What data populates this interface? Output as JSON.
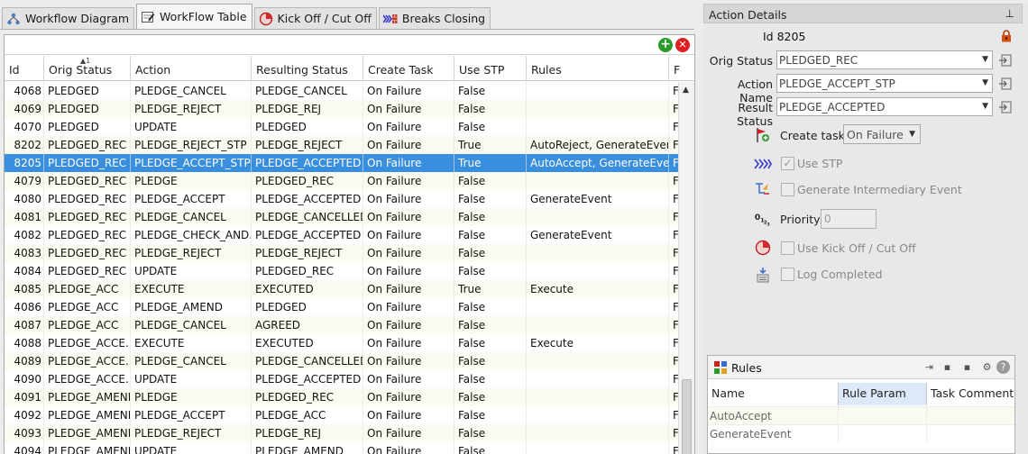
{
  "tabs": [
    {
      "label": "Workflow Diagram",
      "icon": "workflow-diagram-icon",
      "active": false
    },
    {
      "label": "WorkFlow Table",
      "icon": "table-edit-icon",
      "active": true
    },
    {
      "label": "Kick Off / Cut Off",
      "icon": "pie-clock-icon",
      "active": false
    },
    {
      "label": "Breaks Closing",
      "icon": "breaks-closing-icon",
      "active": false
    }
  ],
  "table": {
    "sort_index": "1",
    "columns": [
      "Id",
      "Orig Status",
      "Action",
      "Resulting Status",
      "Create Task",
      "Use STP",
      "Rules",
      "F"
    ],
    "rows": [
      [
        "4068",
        "PLEDGED",
        "PLEDGE_CANCEL",
        "PLEDGE_CANCEL",
        "On Failure",
        "False",
        "",
        "F"
      ],
      [
        "4069",
        "PLEDGED",
        "PLEDGE_REJECT",
        "PLEDGE_REJ",
        "On Failure",
        "False",
        "",
        "F"
      ],
      [
        "4070",
        "PLEDGED",
        "UPDATE",
        "PLEDGED",
        "On Failure",
        "False",
        "",
        "F"
      ],
      [
        "8202",
        "PLEDGED_REC",
        "PLEDGE_REJECT_STP",
        "PLEDGE_REJECT",
        "On Failure",
        "True",
        "AutoReject, GenerateEvent",
        "F"
      ],
      [
        "8205",
        "PLEDGED_REC",
        "PLEDGE_ACCEPT_STP",
        "PLEDGE_ACCEPTED",
        "On Failure",
        "True",
        "AutoAccept, GenerateEvent",
        "F"
      ],
      [
        "4079",
        "PLEDGED_REC",
        "PLEDGE",
        "PLEDGED_REC",
        "On Failure",
        "False",
        "",
        "F"
      ],
      [
        "4080",
        "PLEDGED_REC",
        "PLEDGE_ACCEPT",
        "PLEDGE_ACCEPTED",
        "On Failure",
        "False",
        "GenerateEvent",
        "F"
      ],
      [
        "4081",
        "PLEDGED_REC",
        "PLEDGE_CANCEL",
        "PLEDGE_CANCELLED",
        "On Failure",
        "False",
        "",
        "F"
      ],
      [
        "4082",
        "PLEDGED_REC",
        "PLEDGE_CHECK_AND...",
        "PLEDGE_ACCEPTED",
        "On Failure",
        "False",
        "GenerateEvent",
        "F"
      ],
      [
        "4083",
        "PLEDGED_REC",
        "PLEDGE_REJECT",
        "PLEDGE_REJECT",
        "On Failure",
        "False",
        "",
        "F"
      ],
      [
        "4084",
        "PLEDGED_REC",
        "UPDATE",
        "PLEDGED_REC",
        "On Failure",
        "False",
        "",
        "F"
      ],
      [
        "4085",
        "PLEDGE_ACC",
        "EXECUTE",
        "EXECUTED",
        "On Failure",
        "True",
        "Execute",
        "F"
      ],
      [
        "4086",
        "PLEDGE_ACC",
        "PLEDGE_AMEND",
        "PLEDGED",
        "On Failure",
        "False",
        "",
        "F"
      ],
      [
        "4087",
        "PLEDGE_ACC",
        "PLEDGE_CANCEL",
        "AGREED",
        "On Failure",
        "False",
        "",
        "F"
      ],
      [
        "4088",
        "PLEDGE_ACCE...",
        "EXECUTE",
        "EXECUTED",
        "On Failure",
        "False",
        "Execute",
        "F"
      ],
      [
        "4089",
        "PLEDGE_ACCE...",
        "PLEDGE_CANCEL",
        "PLEDGE_CANCELLED",
        "On Failure",
        "False",
        "",
        "F"
      ],
      [
        "4090",
        "PLEDGE_ACCE...",
        "UPDATE",
        "PLEDGE_ACCEPTED",
        "On Failure",
        "False",
        "",
        "F"
      ],
      [
        "4091",
        "PLEDGE_AMEND",
        "PLEDGE",
        "PLEDGED_REC",
        "On Failure",
        "False",
        "",
        "F"
      ],
      [
        "4092",
        "PLEDGE_AMEND",
        "PLEDGE_ACCEPT",
        "PLEDGE_ACC",
        "On Failure",
        "False",
        "",
        "F"
      ],
      [
        "4093",
        "PLEDGE_AMEND",
        "PLEDGE_REJECT",
        "PLEDGE_REJ",
        "On Failure",
        "False",
        "",
        "F"
      ],
      [
        "4094",
        "PLEDGE_AMEND",
        "UPDATE",
        "PLEDGE_AMEND",
        "On Failure",
        "False",
        "",
        "F"
      ]
    ],
    "selected_row": 4
  },
  "details": {
    "header": "Action Details",
    "id_text": "Id 8205",
    "orig_status_label": "Orig Status",
    "orig_status_value": "PLEDGED_REC",
    "action_name_label": "Action Name",
    "action_name_value": "PLEDGE_ACCEPT_STP",
    "result_status_label": "Result Status",
    "result_status_value": "PLEDGE_ACCEPTED",
    "create_task_label": "Create task",
    "create_task_value": "On Failure",
    "use_stp_label": "Use STP",
    "use_stp_checked": true,
    "generate_event_label": "Generate Intermediary Event",
    "priority_label": "Priority",
    "priority_value": "0",
    "kickoff_label": "Use Kick Off / Cut Off",
    "log_completed_label": "Log Completed"
  },
  "rules": {
    "title": "Rules",
    "columns": [
      "Name",
      "Rule Param",
      "Task Comment"
    ],
    "rows": [
      [
        "AutoAccept",
        "",
        ""
      ],
      [
        "GenerateEvent",
        "",
        ""
      ]
    ]
  }
}
